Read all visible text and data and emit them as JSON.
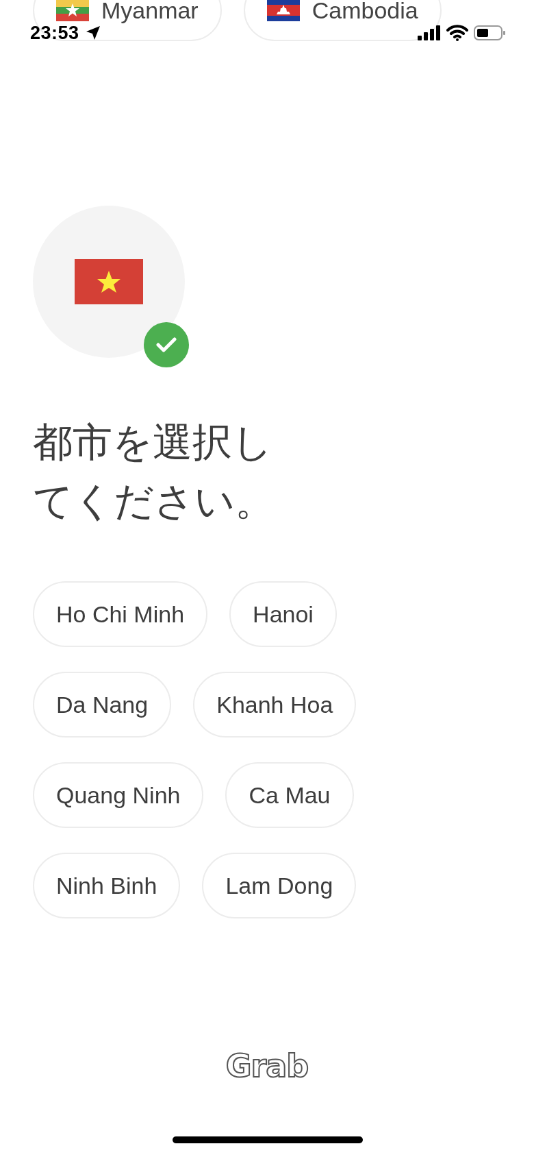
{
  "status_bar": {
    "time": "23:53"
  },
  "previous_countries": [
    {
      "name": "Myanmar",
      "kind": "myanmar"
    },
    {
      "name": "Cambodia",
      "kind": "cambodia"
    }
  ],
  "country": {
    "kind": "vietnam",
    "selected": true
  },
  "heading": "都市を選択してください。",
  "cities": [
    "Ho Chi Minh",
    "Hanoi",
    "Da Nang",
    "Khanh Hoa",
    "Quang Ninh",
    "Ca Mau",
    "Ninh Binh",
    "Lam Dong"
  ],
  "logo": "Grab"
}
